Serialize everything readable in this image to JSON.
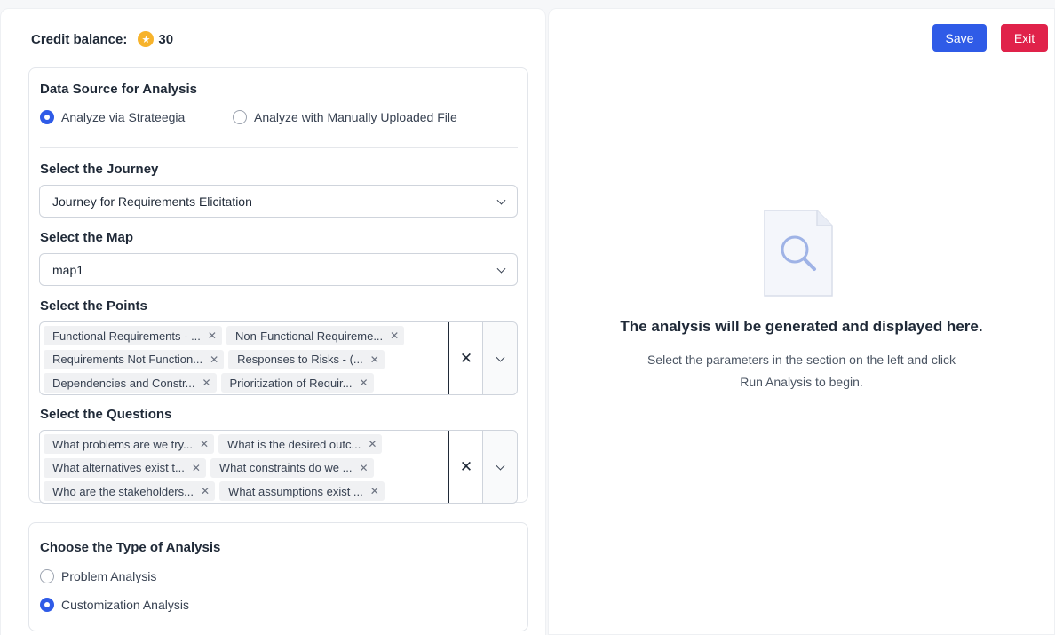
{
  "credit": {
    "label": "Credit balance:",
    "value": "30"
  },
  "actions": {
    "save_label": "Save",
    "exit_label": "Exit"
  },
  "data_source": {
    "title": "Data Source for Analysis",
    "options": [
      {
        "label": "Analyze via Strateegia",
        "checked": true
      },
      {
        "label": "Analyze with Manually Uploaded File",
        "checked": false
      }
    ]
  },
  "journey": {
    "title": "Select the Journey",
    "value": "Journey for Requirements Elicitation"
  },
  "map": {
    "title": "Select the Map",
    "value": "map1"
  },
  "points": {
    "title": "Select the Points",
    "chips": [
      [
        "Functional Requirements - ...",
        "Non-Functional Requireme..."
      ],
      [
        "Requirements Not Function...",
        "Responses to Risks - (..."
      ],
      [
        "Dependencies and Constr...",
        "Prioritization of Requir..."
      ]
    ]
  },
  "questions": {
    "title": "Select the Questions",
    "chips": [
      [
        "What problems are we try...",
        "What is the desired outc..."
      ],
      [
        "What alternatives exist t...",
        "What constraints do we ..."
      ],
      [
        "Who are the stakeholders...",
        "What assumptions exist ..."
      ]
    ]
  },
  "analysis_type": {
    "title": "Choose the Type of Analysis",
    "options": [
      {
        "label": "Problem Analysis",
        "checked": false
      },
      {
        "label": "Customization Analysis",
        "checked": true
      }
    ]
  },
  "empty_state": {
    "title": "The analysis will be generated and displayed here.",
    "line1": "Select the parameters in the section on the left and click",
    "line2": "Run Analysis to begin."
  },
  "colors": {
    "primary": "#2f5be7",
    "danger": "#e0224a",
    "coin": "#f7b32b"
  },
  "icons": {
    "credit": "star-coin-icon",
    "empty": "document-search-icon"
  }
}
